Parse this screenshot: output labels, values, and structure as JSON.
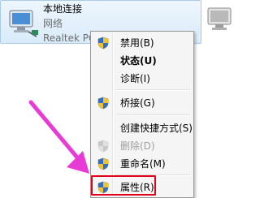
{
  "connection": {
    "name": "本地连接",
    "status": "网络",
    "adapter": "Realtek PCIe GBE Family Controller"
  },
  "menu": {
    "items": [
      {
        "label": "禁用(B)"
      },
      {
        "label": "状态(U)"
      },
      {
        "label": "诊断(I)"
      },
      {
        "label": "桥接(G)"
      },
      {
        "label": "创建快捷方式(S)"
      },
      {
        "label": "删除(D)"
      },
      {
        "label": "重命名(M)"
      },
      {
        "label": "属性(R)"
      }
    ]
  },
  "colors": {
    "highlight_border": "#e3001b",
    "arrow": "#e83bd6",
    "tile_border": "#a9cbe8"
  },
  "icons": [
    "network-adapter-icon",
    "uac-shield-icon",
    "pointer-arrow-icon"
  ]
}
